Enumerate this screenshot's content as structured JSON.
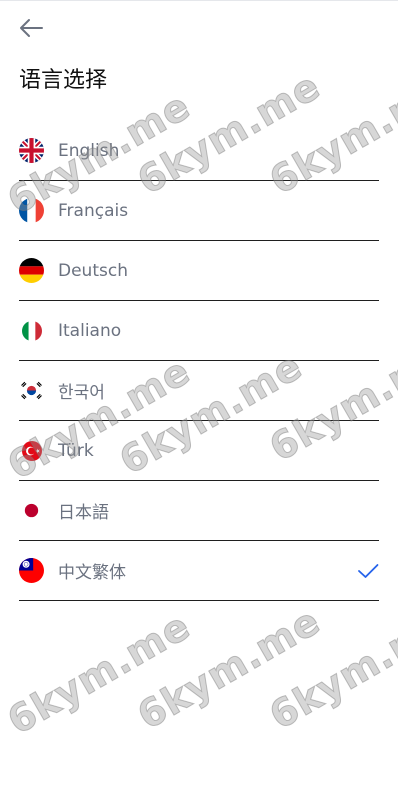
{
  "page": {
    "title": "语言选择"
  },
  "languages": [
    {
      "label": "English",
      "flag_icon": "uk-flag-icon",
      "selected": false
    },
    {
      "label": "Français",
      "flag_icon": "france-flag-icon",
      "selected": false
    },
    {
      "label": "Deutsch",
      "flag_icon": "germany-flag-icon",
      "selected": false
    },
    {
      "label": "Italiano",
      "flag_icon": "italy-flag-icon",
      "selected": false
    },
    {
      "label": "한국어",
      "flag_icon": "korea-flag-icon",
      "selected": false
    },
    {
      "label": "Türk",
      "flag_icon": "turkey-flag-icon",
      "selected": false
    },
    {
      "label": "日本語",
      "flag_icon": "japan-flag-icon",
      "selected": false
    },
    {
      "label": "中文繁体",
      "flag_icon": "taiwan-flag-icon",
      "selected": true
    }
  ],
  "colors": {
    "accent": "#2563eb",
    "label": "#6b7280",
    "divider": "#1f1f1f"
  },
  "watermark": "6kym.me"
}
